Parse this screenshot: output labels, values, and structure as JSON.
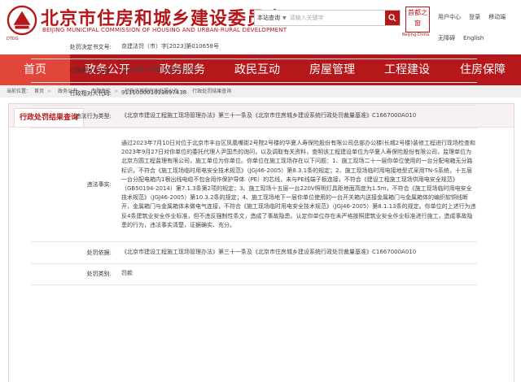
{
  "header": {
    "title": "北京市住房和城乡建设委员会",
    "subtitle": "BEIJING MUNICIPAL COMMISSION OF HOUSING AND URBAN-RURAL DEVELOPMENT",
    "logo_caption": "DTDG",
    "search_scope": "本站查询",
    "search_placeholder": "请输入关键字",
    "badge_text": "首都之窗",
    "badge_caption": "Beijing·China",
    "top_links": [
      "用户中心",
      "登录",
      "移动端",
      "无障碍",
      "English"
    ]
  },
  "nav": {
    "items": [
      "首页",
      "政务公开",
      "政务服务",
      "政民互动",
      "房屋管理",
      "工程建设",
      "住房保障"
    ],
    "active_index": 0
  },
  "breadcrumb": {
    "items": [
      "当前位置：",
      "首页",
      "政务公开",
      "专题专栏",
      "行政许可和行政处罚公示",
      "行政处罚结果查询"
    ]
  },
  "panel": {
    "title": "行政处罚结果查询"
  },
  "record": {
    "rows": [
      {
        "label": "处罚决定书文号:",
        "value": "京建法罚（市）字[2023]第010658号"
      },
      {
        "label": "行政相对人名称:",
        "value": "北京市第三建筑工程有限公司"
      },
      {
        "label": "行政相对人代码:",
        "value": "911100001013897438"
      },
      {
        "label": "违法行为类型:",
        "value": "《北京市建设工程施工现场管理办法》第三十一条及《北京市住房城乡建设系统行政处罚裁量基准》C1667000A010"
      },
      {
        "label": "违法事实:",
        "value": "通过2023年7月10日对位于北京市丰台区凤凰嘴街2号院2号楼的华夏人寿保险股份有限公司总部办公楼(长城2号楼)装修工程进行现场检查和2023年9月27日对你单位的委托代理人尹国杰的询问，以及调取有关资料，查明该工程建设单位为华夏人寿保险股份有限公司，监理单位为北京方圆工程监理有限公司，施工单位为你单位。你单位在施工现场存在以下问题：1、施工现场二十一层你单位使用的一台分配电箱无分路标识，不符合《施工现场临时用电安全技术规范》（JGJ46-2005）第8.3.1条的规定；2、施工现场临时用电接地型式采用TN-S系统，十五层一台分配电箱内1根出线电缆不包含用作保护导体（PE）的芯线，未与PE线端子板连接，不符合《建设工程施工现场供用电安全规范》（GB50194-2014）第7.1.3条第2项的规定；3、施工现场十五层一台220V照明灯具距地面高度为1.5m，不符合《施工现场临时用电安全技术规范》（JGJ46-2005）第10.3.2条的规定；4、施工现场地下一层你单位使用的一台开关箱内送接金属箱门与金属箱体的编织软铜线断开，金属箱门与金属箱体未做电气连接，不符合《施工现场临时用电安全技术规范》（JGJ46-2005）第8.1.13条的规定。你单位的上述行为违反4条建筑业安全作业标准，但不违反强制性条文，造成了事故隐患。认定你单位存在未严格按照建筑业安全作业标准进行施工，造成事故隐患的行为，违法事实清楚，证据确实、充分。"
      },
      {
        "label": "处罚依据:",
        "value": "《北京市建设工程施工现场管理办法》第三十一条及《北京市住房城乡建设系统行政处罚裁量基准》C1667000A010"
      },
      {
        "label": "处罚类别:",
        "value": "罚款"
      }
    ]
  },
  "colors": {
    "brand_red": "#b5171b",
    "nav_active": "#e2453a"
  }
}
